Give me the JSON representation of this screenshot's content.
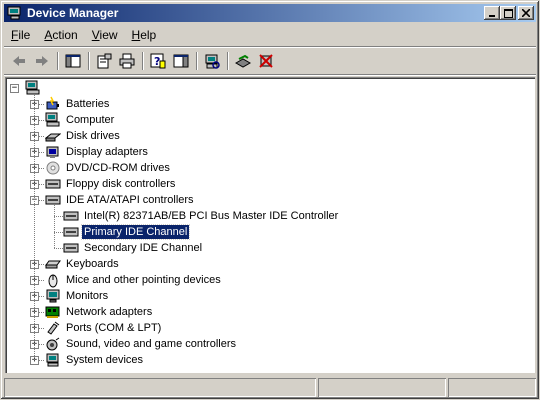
{
  "window": {
    "title": "Device Manager"
  },
  "title_buttons": {
    "minimize": "_",
    "maximize": "□",
    "close": "✕"
  },
  "menu": [
    {
      "label": "File",
      "mnemonic": "F"
    },
    {
      "label": "Action",
      "mnemonic": "A"
    },
    {
      "label": "View",
      "mnemonic": "V"
    },
    {
      "label": "Help",
      "mnemonic": "H"
    }
  ],
  "toolbar": [
    "back-arrow-icon",
    "forward-arrow-icon",
    "show-hide-tree-icon",
    "properties-icon",
    "print-icon",
    "help-icon",
    "show-hide-action-pane-icon",
    "scan-hardware-icon",
    "update-driver-icon",
    "uninstall-icon"
  ],
  "tree": {
    "root": "",
    "categories": [
      {
        "label": "Batteries",
        "icon": "battery-icon"
      },
      {
        "label": "Computer",
        "icon": "computer-icon"
      },
      {
        "label": "Disk drives",
        "icon": "disk-drive-icon"
      },
      {
        "label": "Display adapters",
        "icon": "display-adapter-icon"
      },
      {
        "label": "DVD/CD-ROM drives",
        "icon": "dvd-drive-icon"
      },
      {
        "label": "Floppy disk controllers",
        "icon": "floppy-controller-icon"
      },
      {
        "label": "IDE ATA/ATAPI controllers",
        "icon": "ide-controller-icon",
        "expanded": true,
        "children": [
          {
            "label": "Intel(R) 82371AB/EB PCI Bus Master IDE Controller",
            "icon": "ide-channel-icon"
          },
          {
            "label": "Primary IDE Channel",
            "icon": "ide-channel-icon",
            "selected": true
          },
          {
            "label": "Secondary IDE Channel",
            "icon": "ide-channel-icon"
          }
        ]
      },
      {
        "label": "Keyboards",
        "icon": "keyboard-icon"
      },
      {
        "label": "Mice and other pointing devices",
        "icon": "mouse-icon"
      },
      {
        "label": "Monitors",
        "icon": "monitor-icon"
      },
      {
        "label": "Network adapters",
        "icon": "network-adapter-icon"
      },
      {
        "label": "Ports (COM & LPT)",
        "icon": "port-icon"
      },
      {
        "label": "Sound, video and game controllers",
        "icon": "sound-icon"
      },
      {
        "label": "System devices",
        "icon": "system-device-icon"
      }
    ]
  },
  "colors": {
    "selection": "#0a246a",
    "title_start": "#0a246a",
    "title_end": "#a6caf0",
    "face": "#d4d0c8"
  }
}
